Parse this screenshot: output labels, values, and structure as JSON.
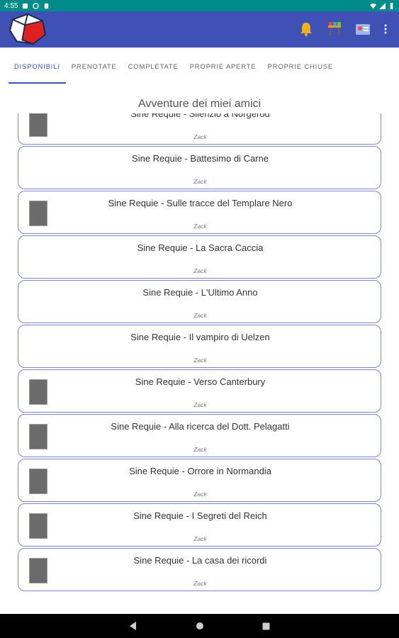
{
  "status_bar": {
    "time": "4:55"
  },
  "tabs": [
    {
      "label": "DISPONIBILI",
      "active": true
    },
    {
      "label": "PRENOTATE",
      "active": false
    },
    {
      "label": "COMPLETATE",
      "active": false
    },
    {
      "label": "PROPRIE APERTE",
      "active": false
    },
    {
      "label": "PROPRIE CHIUSE",
      "active": false
    }
  ],
  "section_title": "Avventure dei miei amici",
  "adventures": [
    {
      "title": "Sine Requie - Silenzio a Norgerod",
      "author": "Zack",
      "has_thumb": true
    },
    {
      "title": "Sine Requie - Battesimo di Carne",
      "author": "Zack",
      "has_thumb": false
    },
    {
      "title": "Sine Requie - Sulle tracce del Templare Nero",
      "author": "Zack",
      "has_thumb": true
    },
    {
      "title": "Sine Requie - La Sacra Caccia",
      "author": "Zack",
      "has_thumb": false
    },
    {
      "title": "Sine Requie - L'Ultimo Anno",
      "author": "Zack",
      "has_thumb": false
    },
    {
      "title": "Sine Requie - Il vampiro di Uelzen",
      "author": "Zack",
      "has_thumb": false
    },
    {
      "title": "Sine Requie - Verso Canterbury",
      "author": "Zack",
      "has_thumb": true
    },
    {
      "title": "Sine Requie - Alla ricerca del Dott. Pelagatti",
      "author": "Zack",
      "has_thumb": true
    },
    {
      "title": "Sine Requie - Orrore in Normandia",
      "author": "Zack",
      "has_thumb": true
    },
    {
      "title": "Sine Requie - I Segreti del Reich",
      "author": "Zack",
      "has_thumb": true
    },
    {
      "title": "Sine Requie - La casa dei ricordi",
      "author": "Zack",
      "has_thumb": true
    }
  ],
  "colors": {
    "appbar": "#3f51b5",
    "statusbar": "#008b8b",
    "card_border": "#7d86c8"
  },
  "icons": {
    "appbar_actions": [
      "bell-icon",
      "dice-table-icon",
      "profile-card-icon",
      "more-vert-icon"
    ],
    "nav": [
      "back-icon",
      "home-icon",
      "recents-icon"
    ]
  }
}
